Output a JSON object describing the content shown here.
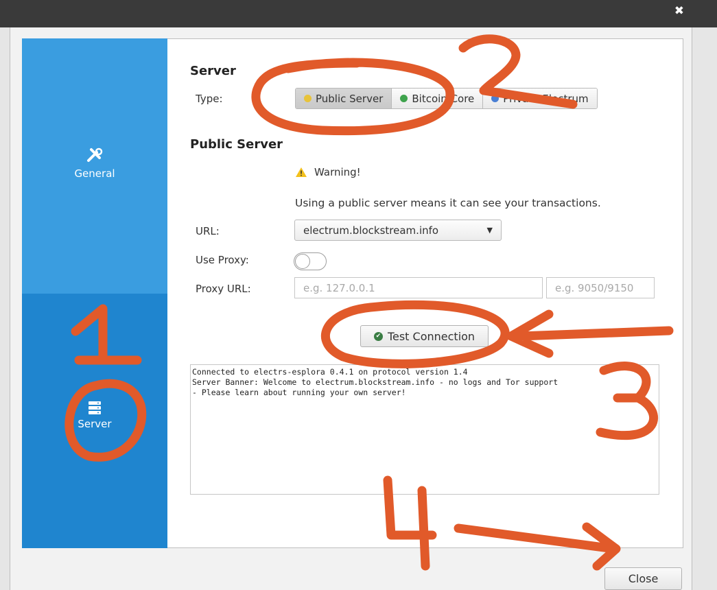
{
  "window": {
    "close_glyph": "✖"
  },
  "sidebar": {
    "items": [
      {
        "label": "General",
        "icon": "tools-icon",
        "selected": false
      },
      {
        "label": "Server",
        "icon": "server-icon",
        "selected": true
      }
    ]
  },
  "server_section": {
    "heading": "Server",
    "type_label": "Type:",
    "types": [
      {
        "label": "Public Server",
        "dot_color": "#e8c33a",
        "selected": true
      },
      {
        "label": "Bitcoin Core",
        "dot_color": "#3fa34d",
        "selected": false
      },
      {
        "label": "Private Electrum",
        "dot_color": "#4a7fd4",
        "selected": false
      }
    ]
  },
  "public_server": {
    "heading": "Public Server",
    "warning_title": "Warning!",
    "warning_text": "Using a public server means it can see your transactions.",
    "url_label": "URL:",
    "url_value": "electrum.blockstream.info",
    "proxy_label": "Use Proxy:",
    "proxy_enabled": false,
    "proxy_url_label": "Proxy URL:",
    "proxy_host_placeholder": "e.g. 127.0.0.1",
    "proxy_port_placeholder": "e.g. 9050/9150",
    "test_button": "Test Connection"
  },
  "console": {
    "lines": [
      "Connected to electrs-esplora 0.4.1 on protocol version 1.4",
      "Server Banner: Welcome to electrum.blockstream.info - no logs and Tor support",
      "- Please learn about running your own server!"
    ]
  },
  "footer": {
    "close_button": "Close"
  },
  "annotations": {
    "color": "#e15a2a",
    "labels": [
      "1",
      "2",
      "3",
      "4"
    ]
  }
}
